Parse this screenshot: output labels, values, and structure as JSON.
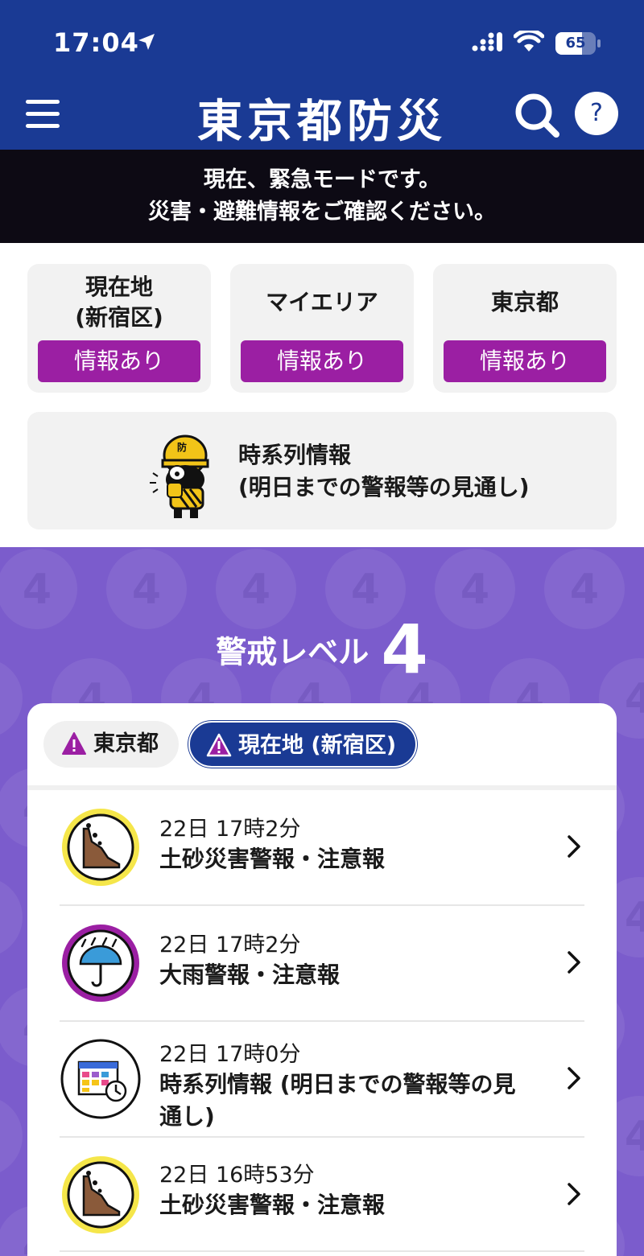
{
  "status_bar": {
    "time": "17:04",
    "battery": "65",
    "battery_level": 0.65
  },
  "header": {
    "title": "東京都防災",
    "help_label": "?"
  },
  "emergency_banner": {
    "line1": "現在、緊急モードです。",
    "line2": "災害・避難情報をご確認ください。"
  },
  "areas": [
    {
      "name_line1": "現在地",
      "name_line2": "(新宿区)",
      "status": "情報あり"
    },
    {
      "name_line1": "マイエリア",
      "name_line2": "",
      "status": "情報あり"
    },
    {
      "name_line1": "東京都",
      "name_line2": "",
      "status": "情報あり"
    }
  ],
  "timeline_card": {
    "line1": "時系列情報",
    "line2": "(明日までの警報等の見通し)",
    "mascot_badge": "防"
  },
  "warning_level": {
    "label": "警戒レベル",
    "level": "4",
    "pattern_digit": "4"
  },
  "tabs": [
    {
      "label": "東京都",
      "active": false
    },
    {
      "label": "現在地 (新宿区)",
      "active": true
    }
  ],
  "alerts": [
    {
      "time": "22日 17時2分",
      "title": "土砂災害警報・注意報",
      "icon": "landslide-icon",
      "ring_color": "#f5e64a"
    },
    {
      "time": "22日 17時2分",
      "title": "大雨警報・注意報",
      "icon": "heavy-rain-icon",
      "ring_color": "#9b1fa3"
    },
    {
      "time": "22日 17時0分",
      "title": "時系列情報 (明日までの警報等の見通し)",
      "icon": "calendar-clock-icon",
      "ring_color": "#ffffff"
    },
    {
      "time": "22日 16時53分",
      "title": "土砂災害警報・注意報",
      "icon": "landslide-icon",
      "ring_color": "#f5e64a"
    }
  ],
  "colors": {
    "header": "#1a3a94",
    "banner": "#0d0a14",
    "status_badge": "#9b1fa3",
    "level_bg": "#7b5ccc"
  }
}
